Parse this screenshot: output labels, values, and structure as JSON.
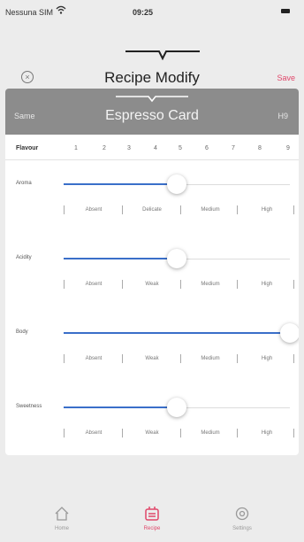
{
  "status": {
    "carrier": "Nessuna SIM",
    "time": "09:25"
  },
  "nav": {
    "title": "Recipe Modify",
    "save_label": "Save",
    "close_glyph": "×"
  },
  "card": {
    "title": "Espresso Card",
    "left_label": "Same",
    "right_label": "H9"
  },
  "flavor": {
    "label": "Flavour",
    "numbers": [
      "1",
      "2",
      "3",
      "4",
      "5",
      "6",
      "7",
      "8",
      "9"
    ]
  },
  "sliders": [
    {
      "label": "Aroma",
      "value": 0.5,
      "options": [
        "Absent",
        "Delicate",
        "Medium",
        "High"
      ]
    },
    {
      "label": "Acidity",
      "value": 0.5,
      "options": [
        "Absent",
        "Weak",
        "Medium",
        "High"
      ]
    },
    {
      "label": "Body",
      "value": 1.0,
      "options": [
        "Absent",
        "Weak",
        "Medium",
        "High"
      ]
    },
    {
      "label": "Sweetness",
      "value": 0.5,
      "options": [
        "Absent",
        "Weak",
        "Medium",
        "High"
      ]
    }
  ],
  "tabs": [
    {
      "label": "Home",
      "icon": "home-icon",
      "active": false
    },
    {
      "label": "Recipe",
      "icon": "recipe-icon",
      "active": true
    },
    {
      "label": "Settings",
      "icon": "settings-icon",
      "active": false
    }
  ],
  "colors": {
    "accent": "#e0476a",
    "slider_fill": "#3a6fc9",
    "header_bg": "#8c8c8c"
  }
}
